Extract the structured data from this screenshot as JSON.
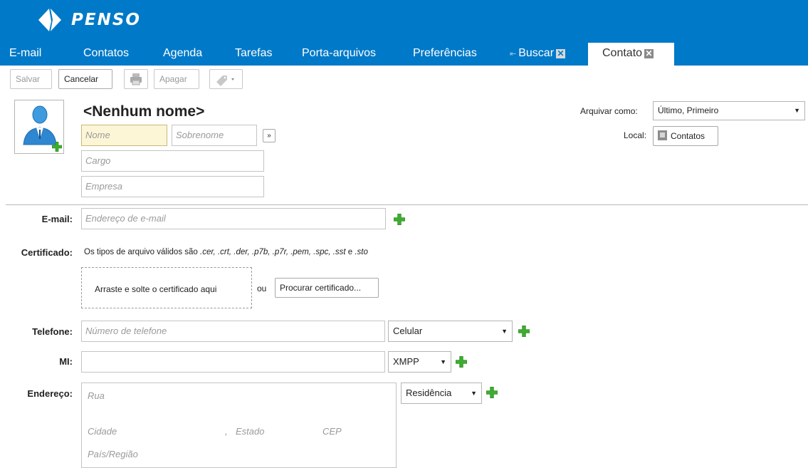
{
  "app": {
    "logo_text": "PENSO"
  },
  "tabs": [
    {
      "label": "E-mail"
    },
    {
      "label": "Contatos"
    },
    {
      "label": "Agenda"
    },
    {
      "label": "Tarefas"
    },
    {
      "label": "Porta-arquivos"
    },
    {
      "label": "Preferências"
    },
    {
      "label": "Buscar",
      "closable": true
    },
    {
      "label": "Contato",
      "closable": true,
      "active": true
    }
  ],
  "toolbar": {
    "save_label": "Salvar",
    "cancel_label": "Cancelar",
    "print_icon": "printer-icon",
    "delete_label": "Apagar",
    "tag_icon": "tag-icon"
  },
  "contact": {
    "display_name": "<Nenhum nome>",
    "first_name_placeholder": "Nome",
    "last_name_placeholder": "Sobrenome",
    "expand_label": "»",
    "job_title_placeholder": "Cargo",
    "company_placeholder": "Empresa",
    "file_as_label": "Arquivar como:",
    "file_as_value": "Último, Primeiro",
    "location_label": "Local:",
    "location_value": "Contatos"
  },
  "email": {
    "label": "E-mail:",
    "placeholder": "Endereço de e-mail"
  },
  "certificate": {
    "label": "Certificado:",
    "info_prefix": "Os tipos de arquivo válidos são ",
    "info_types": ".cer, .crt, .der, .p7b, .p7r, .pem, .spc, .sst",
    "info_and": " e ",
    "info_last": ".sto",
    "drop_text": "Arraste e solte o certificado aqui",
    "or_text": "ou",
    "browse_label": "Procurar certificado..."
  },
  "phone": {
    "label": "Telefone:",
    "placeholder": "Número de telefone",
    "type_value": "Celular"
  },
  "im": {
    "label": "MI:",
    "value": "",
    "type_value": "XMPP"
  },
  "address": {
    "label": "Endereço:",
    "street_placeholder": "Rua",
    "city_placeholder": "Cidade",
    "separator": ",",
    "state_placeholder": "Estado",
    "zip_placeholder": "CEP",
    "country_placeholder": "País/Região",
    "type_value": "Residência"
  },
  "colors": {
    "brand": "#0079c8",
    "add": "#3cae2e",
    "focus_field": "#fcf6d6"
  }
}
